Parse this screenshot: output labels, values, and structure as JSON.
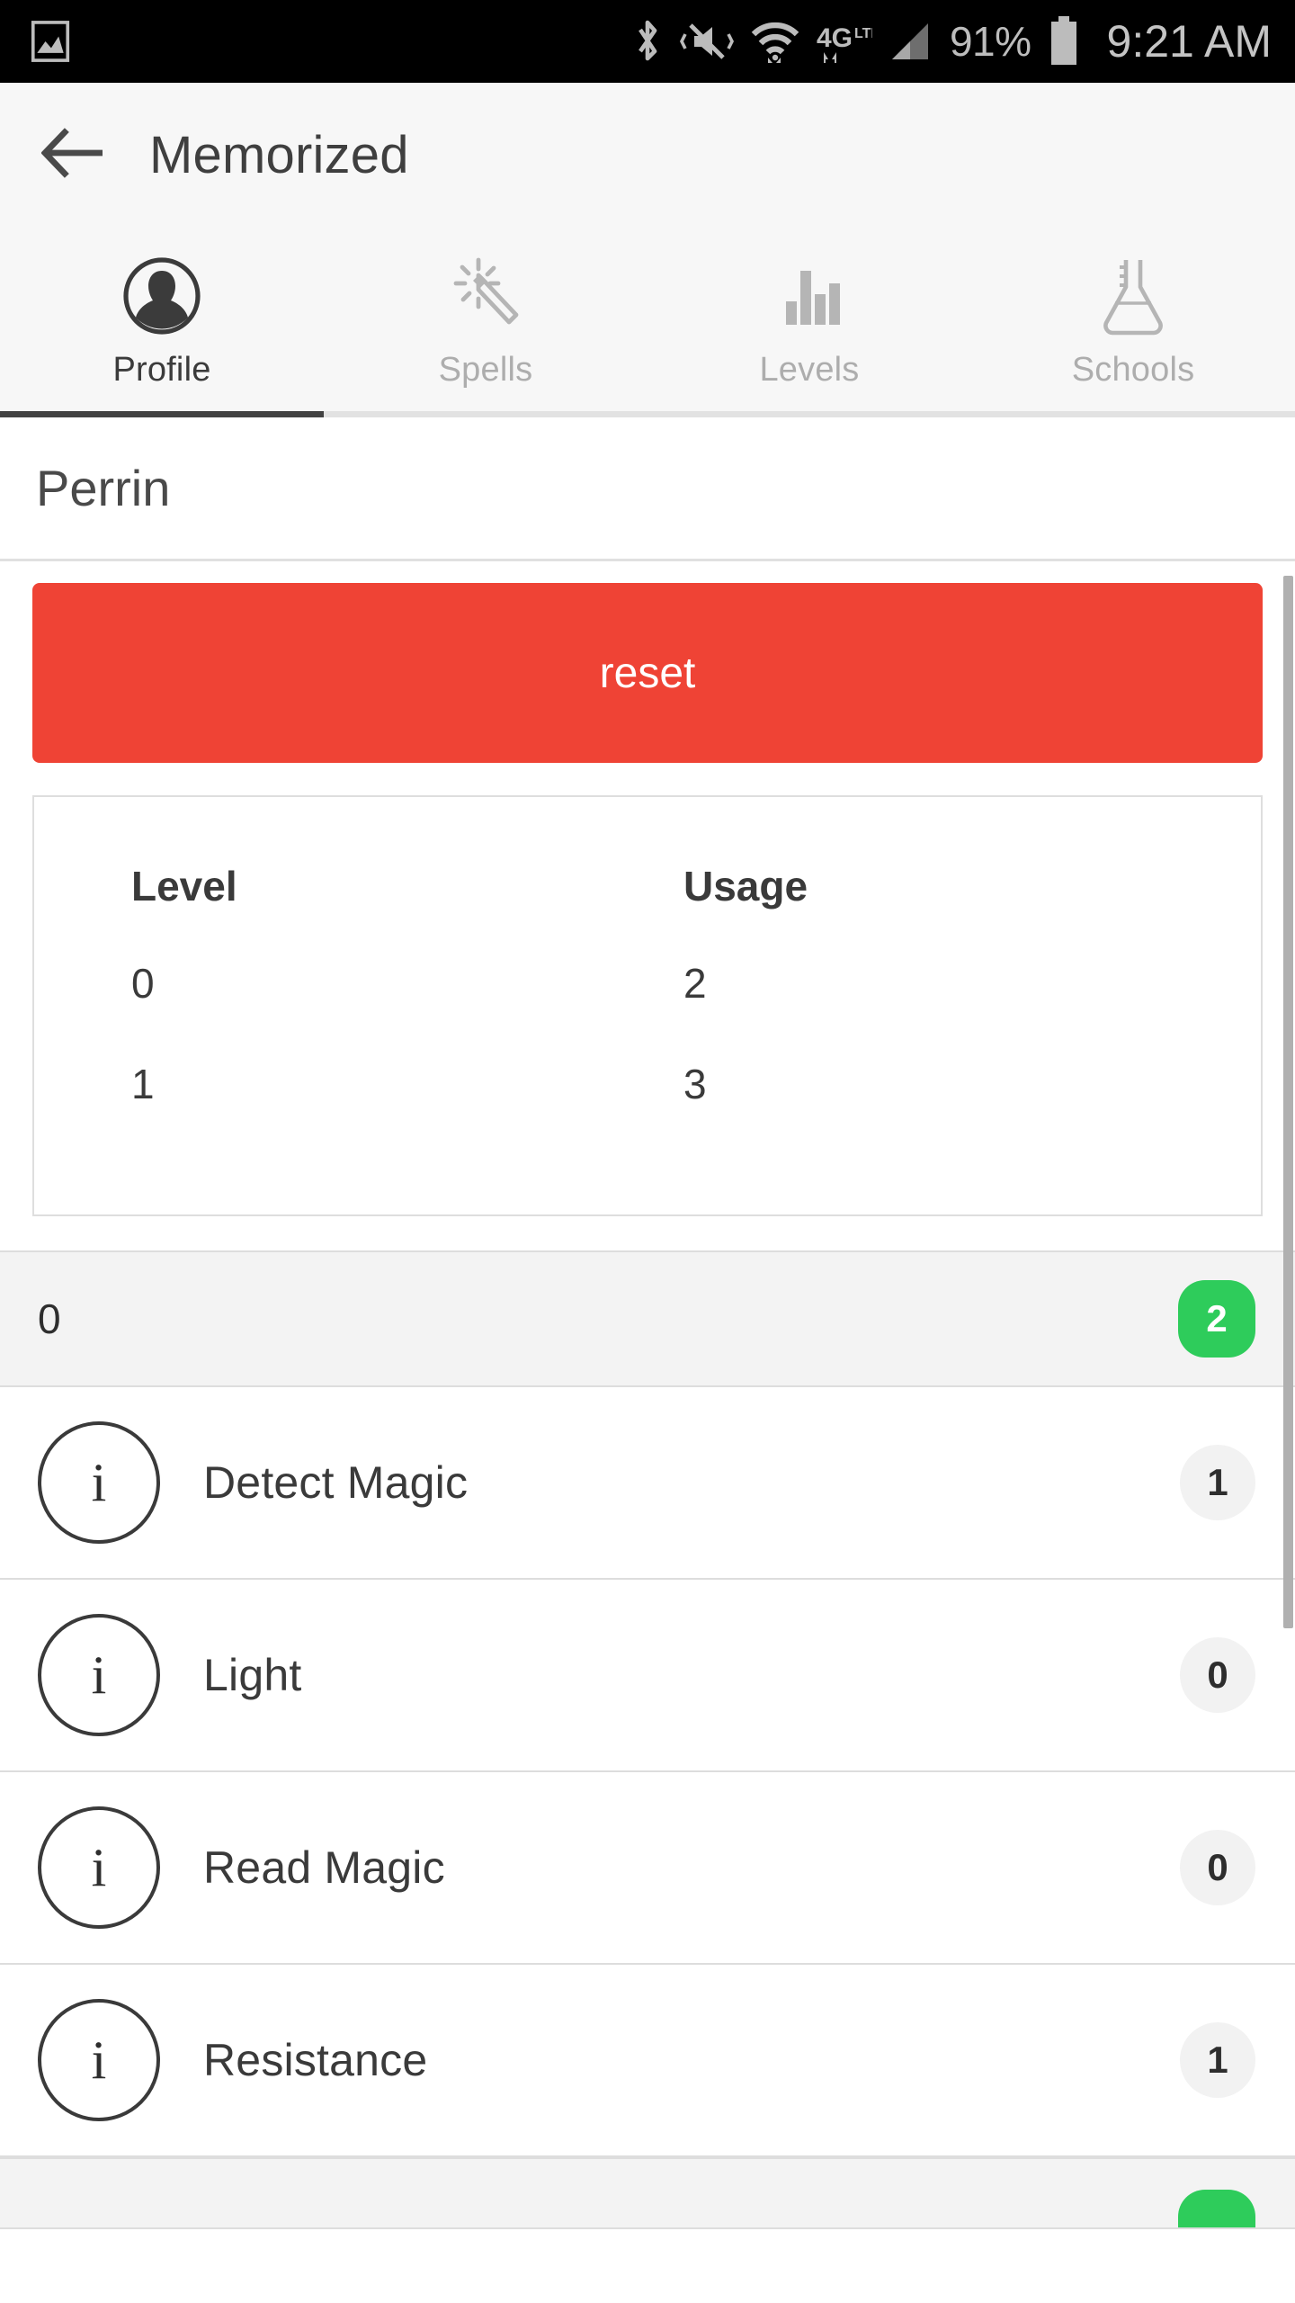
{
  "status_bar": {
    "battery_percent": "91%",
    "time": "9:21 AM",
    "icons": [
      "image-icon",
      "bluetooth-icon",
      "vibrate-mute-icon",
      "wifi-icon",
      "4g-lte-icon",
      "signal-bars-icon",
      "battery-icon"
    ]
  },
  "app_bar": {
    "back_icon": "back-arrow-icon",
    "title": "Memorized"
  },
  "tabs": [
    {
      "label": "Profile",
      "icon": "person-circle-icon",
      "active": true
    },
    {
      "label": "Spells",
      "icon": "magic-wand-icon",
      "active": false
    },
    {
      "label": "Levels",
      "icon": "bar-chart-icon",
      "active": false
    },
    {
      "label": "Schools",
      "icon": "flask-icon",
      "active": false
    }
  ],
  "character": {
    "name": "Perrin"
  },
  "actions": {
    "reset_label": "reset",
    "reset_color": "#ef4335"
  },
  "usage_table": {
    "headers": [
      "Level",
      "Usage"
    ],
    "rows": [
      [
        "0",
        "2"
      ],
      [
        "1",
        "3"
      ]
    ]
  },
  "spell_groups": [
    {
      "level": "0",
      "count": "2",
      "badge_color": "#2ecc5b",
      "spells": [
        {
          "info_icon": "info-circle-icon",
          "name": "Detect Magic",
          "count": "1"
        },
        {
          "info_icon": "info-circle-icon",
          "name": "Light",
          "count": "0"
        },
        {
          "info_icon": "info-circle-icon",
          "name": "Read Magic",
          "count": "0"
        },
        {
          "info_icon": "info-circle-icon",
          "name": "Resistance",
          "count": "1"
        }
      ]
    },
    {
      "level": "",
      "count": "",
      "badge_color": "#2ecc5b",
      "partial": true,
      "spells": []
    }
  ]
}
